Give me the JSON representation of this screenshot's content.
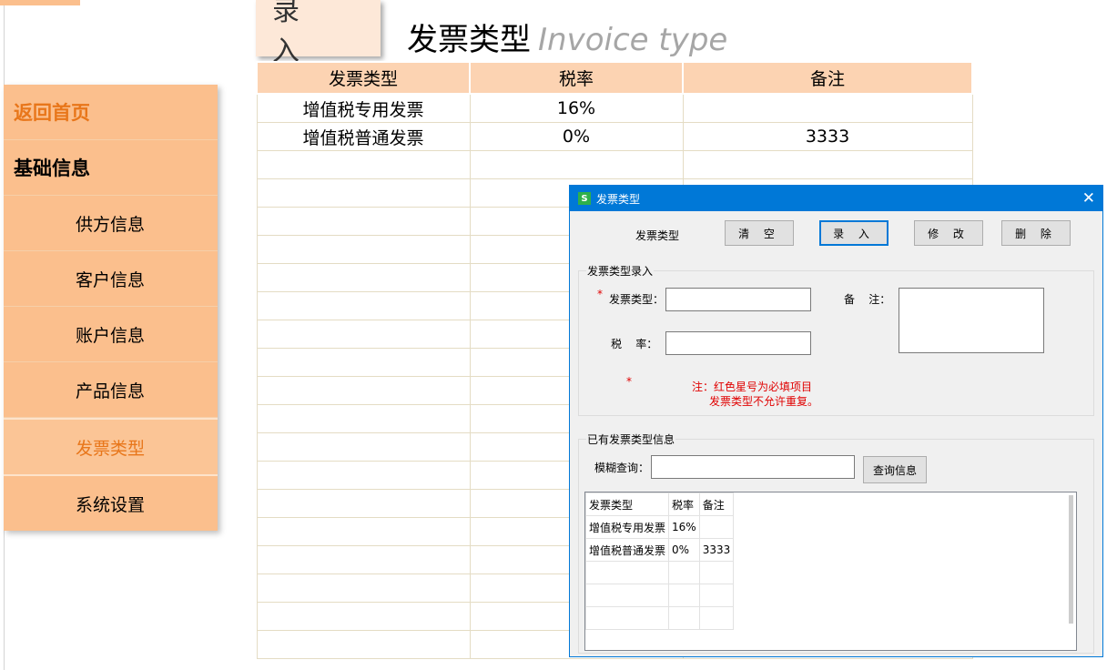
{
  "sidebar": {
    "home": "返回首页",
    "section": "基础信息",
    "items": [
      "供方信息",
      "客户信息",
      "账户信息",
      "产品信息",
      "发票类型",
      "系统设置"
    ],
    "active": "发票类型"
  },
  "header": {
    "entry_button": "录 入",
    "title_cn": "发票类型",
    "title_en": "Invoice type"
  },
  "table": {
    "headers": [
      "发票类型",
      "税率",
      "备注"
    ],
    "rows": [
      [
        "增值税专用发票",
        "16%",
        ""
      ],
      [
        "增值税普通发票",
        "0%",
        "3333"
      ]
    ]
  },
  "dialog": {
    "title": "发票类型",
    "top_label": "发票类型",
    "buttons": {
      "clear": "清 空",
      "enter": "录 入",
      "modify": "修 改",
      "delete": "删 除"
    },
    "entry_group": {
      "title": "发票类型录入",
      "type_label": "发票类型：",
      "tax_label": "税    率：",
      "note_label": "备    注：",
      "asterisk": "*",
      "note_line1": "注：红色星号为必填项目",
      "note_line2": "发票类型不允许重复。"
    },
    "existing_group": {
      "title": "已有发票类型信息",
      "search_label": "模糊查询：",
      "search_button": "查询信息",
      "grid_headers": [
        "发票类型",
        "税率",
        "备注"
      ],
      "grid_rows": [
        [
          "增值税专用发票",
          "16%",
          ""
        ],
        [
          "增值税普通发票",
          "0%",
          "3333"
        ]
      ]
    }
  },
  "colors": {
    "sidebar": "#fbbf8d",
    "accent": "#e8761a",
    "header": "#fcd3b2",
    "titlebar": "#0078d7"
  }
}
